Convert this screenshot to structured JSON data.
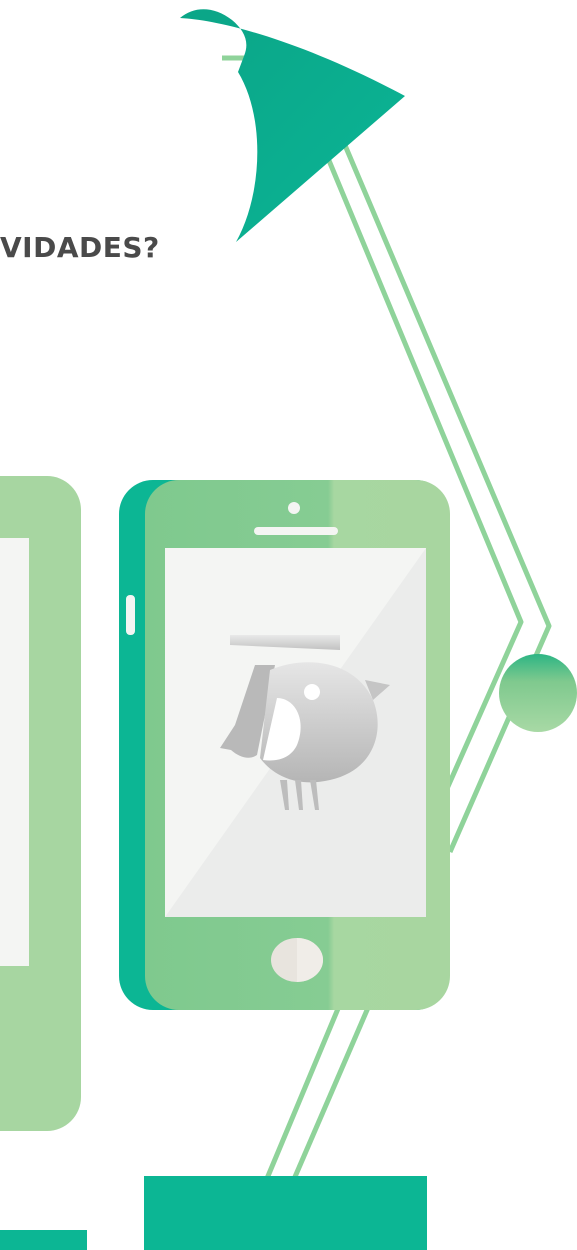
{
  "headline": {
    "text": "VIDADES?"
  },
  "colors": {
    "lamp_dark_green": "#0aa88a",
    "lamp_light_green": "#0cb694",
    "arm_green": "#8fd39a",
    "device_green": "#86cc93",
    "device_light_green": "#a8d6a0",
    "screen_white": "#f4f5f3",
    "logo_gray": "#c9c9c9",
    "text_gray": "#4a4a4a"
  },
  "icons": {
    "lamp": "desk-lamp-icon",
    "phone": "smartphone-icon",
    "tablet": "tablet-icon",
    "logo": "bird-logo-icon"
  }
}
